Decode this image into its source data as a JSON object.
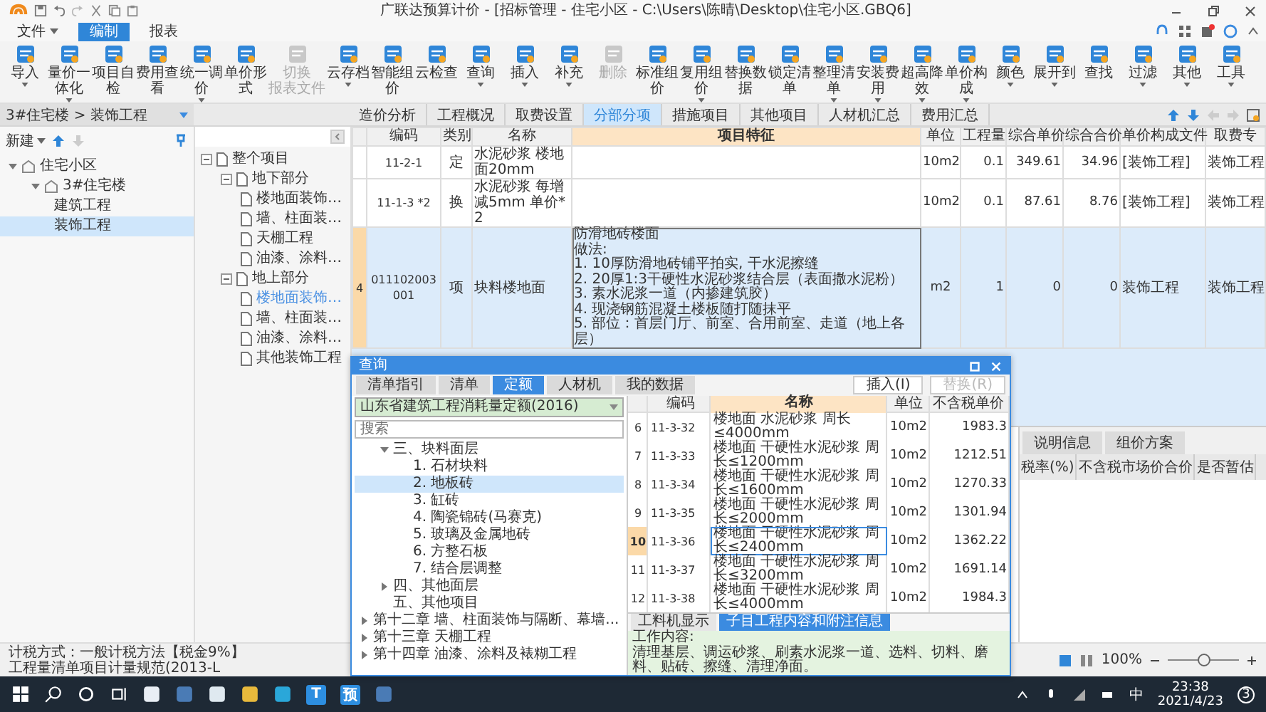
{
  "title_bar": {
    "title": "广联达预算计价 - [招标管理 - 住宅小区 - C:\\Users\\陈晴\\Desktop\\住宅小区.GBQ6]"
  },
  "menu": [
    {
      "label": "文件",
      "dropdown": true,
      "selected": false
    },
    {
      "label": "编制",
      "dropdown": false,
      "selected": true
    },
    {
      "label": "报表",
      "dropdown": false,
      "selected": false
    }
  ],
  "toolbar": [
    {
      "label": "导入",
      "dropdown": true,
      "disabled": false
    },
    {
      "label": "量价一体化",
      "dropdown": true,
      "disabled": false
    },
    {
      "label": "项目自检",
      "dropdown": false,
      "disabled": false
    },
    {
      "label": "费用查看",
      "dropdown": false,
      "disabled": false
    },
    {
      "label": "统一调价",
      "dropdown": true,
      "disabled": false
    },
    {
      "label": "单价形式",
      "dropdown": false,
      "disabled": false
    },
    {
      "label": "切换",
      "sub": "报表文件",
      "dropdown": false,
      "disabled": true
    },
    {
      "label": "云存档",
      "dropdown": true,
      "disabled": false
    },
    {
      "label": "智能组价",
      "dropdown": false,
      "disabled": false
    },
    {
      "label": "云检查",
      "dropdown": false,
      "disabled": false
    },
    {
      "label": "查询",
      "dropdown": true,
      "disabled": false
    },
    {
      "label": "插入",
      "dropdown": true,
      "disabled": false
    },
    {
      "label": "补充",
      "dropdown": true,
      "disabled": false
    },
    {
      "label": "删除",
      "dropdown": false,
      "disabled": true
    },
    {
      "label": "标准组价",
      "dropdown": false,
      "disabled": false
    },
    {
      "label": "复用组价",
      "dropdown": true,
      "disabled": false
    },
    {
      "label": "替换数据",
      "dropdown": false,
      "disabled": false
    },
    {
      "label": "锁定清单",
      "dropdown": false,
      "disabled": false
    },
    {
      "label": "整理清单",
      "dropdown": true,
      "disabled": false
    },
    {
      "label": "安装费用",
      "dropdown": true,
      "disabled": false
    },
    {
      "label": "超高降效",
      "dropdown": true,
      "disabled": false
    },
    {
      "label": "单价构成",
      "dropdown": true,
      "disabled": false
    },
    {
      "label": "颜色",
      "dropdown": true,
      "disabled": false
    },
    {
      "label": "展开到",
      "dropdown": true,
      "disabled": false
    },
    {
      "label": "查找",
      "dropdown": false,
      "disabled": false
    },
    {
      "label": "过滤",
      "dropdown": true,
      "disabled": false
    },
    {
      "label": "其他",
      "dropdown": true,
      "disabled": false
    },
    {
      "label": "工具",
      "dropdown": true,
      "disabled": false
    }
  ],
  "breadcrumb": "3#住宅楼 > 装饰工程",
  "view_tabs": [
    {
      "label": "造价分析",
      "selected": false
    },
    {
      "label": "工程概况",
      "selected": false
    },
    {
      "label": "取费设置",
      "selected": false
    },
    {
      "label": "分部分项",
      "selected": true
    },
    {
      "label": "措施项目",
      "selected": false
    },
    {
      "label": "其他项目",
      "selected": false
    },
    {
      "label": "人材机汇总",
      "selected": false
    },
    {
      "label": "费用汇总",
      "selected": false
    }
  ],
  "project_tree": {
    "new_label": "新建",
    "items": [
      {
        "label": "住宅小区",
        "expanded": true,
        "selected": false,
        "children": [
          {
            "label": "3#住宅楼",
            "expanded": true,
            "selected": false,
            "children": [
              {
                "label": "建筑工程",
                "selected": false
              },
              {
                "label": "装饰工程",
                "selected": true
              }
            ]
          }
        ]
      }
    ]
  },
  "section_tree": {
    "items": [
      {
        "label": "整个项目",
        "expanded": true,
        "selected": false,
        "children": [
          {
            "label": "地下部分",
            "expanded": true,
            "selected": false,
            "children": [
              {
                "label": "楼地面装饰…",
                "selected": false
              },
              {
                "label": "墙、柱面装…",
                "selected": false
              },
              {
                "label": "天棚工程",
                "selected": false
              },
              {
                "label": "油漆、涂料…",
                "selected": false
              }
            ]
          },
          {
            "label": "地上部分",
            "expanded": true,
            "selected": false,
            "children": [
              {
                "label": "楼地面装饰…",
                "selected": true
              },
              {
                "label": "墙、柱面装…",
                "selected": false
              },
              {
                "label": "油漆、涂料…",
                "selected": false
              },
              {
                "label": "其他装饰工程",
                "selected": false
              }
            ]
          }
        ]
      }
    ]
  },
  "table": {
    "columns": [
      "编码",
      "类别",
      "名称",
      "项目特征",
      "单位",
      "工程量",
      "综合单价",
      "综合合价",
      "单价构成文件",
      "取费专"
    ],
    "rows": [
      {
        "index": "",
        "selected": false,
        "cells": [
          "11-2-1",
          "定",
          "水泥砂浆 楼地面20mm",
          "",
          "10m2",
          "0.1",
          "349.61",
          "34.96",
          "[装饰工程]",
          "装饰工程"
        ]
      },
      {
        "index": "",
        "selected": false,
        "cells": [
          "11-1-3 *2",
          "换",
          "水泥砂浆 每增减5mm  单价*2",
          "",
          "10m2",
          "0.1",
          "87.61",
          "8.76",
          "[装饰工程]",
          "装饰工程"
        ]
      },
      {
        "index": "4",
        "selected": true,
        "cells": [
          "011102003001",
          "项",
          "块料楼地面",
          [
            "防滑地砖楼面",
            "做法:",
            "1. 10厚防滑地砖铺平拍实, 干水泥擦缝",
            "2. 20厚1:3干硬性水泥砂浆结合层（表面撒水泥粉）",
            "3. 素水泥浆一道（内掺建筑胶）",
            "4. 现浇钢筋混凝土楼板随打随抹平",
            "5. 部位：首层门厅、前室、合用前室、走道（地上各层）"
          ],
          "m2",
          "1",
          "0",
          "0",
          "装饰工程",
          "装饰工程"
        ]
      }
    ]
  },
  "detail_panel": {
    "tabs": [
      {
        "label": "说明信息",
        "selected": false
      },
      {
        "label": "组价方案",
        "selected": false
      }
    ],
    "columns": [
      "税率(%)",
      "不含税市场价合价",
      "是否暂估"
    ]
  },
  "dialog": {
    "title": "查询",
    "tabs": [
      {
        "label": "清单指引",
        "selected": false
      },
      {
        "label": "清单",
        "selected": false
      },
      {
        "label": "定额",
        "selected": true
      },
      {
        "label": "人材机",
        "selected": false
      },
      {
        "label": "我的数据",
        "selected": false
      }
    ],
    "buttons": [
      {
        "label": "插入(I)",
        "disabled": false
      },
      {
        "label": "替换(R)",
        "disabled": true
      }
    ],
    "library": "山东省建筑工程消耗量定额(2016)",
    "search": {
      "placeholder": "搜索"
    },
    "tree": [
      {
        "children": [
          {
            "label": "三、块料面层",
            "expanded": true,
            "selected": false,
            "children": [
              {
                "label": "1. 石材块料",
                "selected": false
              },
              {
                "label": "2. 地板砖",
                "selected": true
              },
              {
                "label": "3. 缸砖",
                "selected": false
              },
              {
                "label": "4. 陶瓷锦砖(马赛克)",
                "selected": false
              },
              {
                "label": "5. 玻璃及金属地砖",
                "selected": false
              },
              {
                "label": "6. 方整石板",
                "selected": false
              },
              {
                "label": "7. 结合层调整",
                "selected": false
              }
            ]
          },
          {
            "label": "四、其他面层",
            "expanded": false,
            "selected": false
          },
          {
            "label": "五、其他项目",
            "selected": false
          }
        ]
      },
      {
        "label": "第十二章 墙、柱面装饰与隔断、幕墙...",
        "expanded": false,
        "selected": false
      },
      {
        "label": "第十三章 天棚工程",
        "expanded": false,
        "selected": false
      },
      {
        "label": "第十四章 油漆、涂料及裱糊工程",
        "expanded": false,
        "selected": false
      }
    ],
    "columns": [
      "编码",
      "名称",
      "单位",
      "不含税单价"
    ],
    "rows": [
      {
        "no": "6",
        "code": "11-3-32",
        "name": "楼地面 水泥砂浆 周长≤4000mm",
        "unit": "10m2",
        "price": "1983.3",
        "selected": false
      },
      {
        "no": "7",
        "code": "11-3-33",
        "name": "楼地面 干硬性水泥砂浆 周长≤1200mm",
        "unit": "10m2",
        "price": "1212.51",
        "selected": false
      },
      {
        "no": "8",
        "code": "11-3-34",
        "name": "楼地面 干硬性水泥砂浆 周长≤1600mm",
        "unit": "10m2",
        "price": "1270.33",
        "selected": false
      },
      {
        "no": "9",
        "code": "11-3-35",
        "name": "楼地面 干硬性水泥砂浆 周长≤2000mm",
        "unit": "10m2",
        "price": "1301.94",
        "selected": false
      },
      {
        "no": "10",
        "code": "11-3-36",
        "name": "楼地面 干硬性水泥砂浆 周长≤2400mm",
        "unit": "10m2",
        "price": "1362.22",
        "selected": true
      },
      {
        "no": "11",
        "code": "11-3-37",
        "name": "楼地面 干硬性水泥砂浆 周长≤3200mm",
        "unit": "10m2",
        "price": "1691.14",
        "selected": false
      },
      {
        "no": "12",
        "code": "11-3-38",
        "name": "楼地面 干硬性水泥砂浆 周长≤4000mm",
        "unit": "10m2",
        "price": "1984.3",
        "selected": false
      }
    ],
    "info_tabs": [
      {
        "label": "工料机显示",
        "selected": false
      },
      {
        "label": "子目工程内容和附注信息",
        "selected": true
      }
    ],
    "info_heading": "工作内容:",
    "info_text": "清理基层、调运砂浆、刷素水泥浆一道、选料、切料、磨料、贴砖、擦缝、清理净面。"
  },
  "status_bar": {
    "tax": "计税方式：一般计税方法【税金9%】",
    "spec": "工程量清单项目计量规范(2013-L",
    "zoom": "100%",
    "zoom_slider": {
      "level": 0.5
    }
  },
  "taskbar": {
    "apps": [
      {
        "kind": "tile"
      },
      {
        "kind": "tile"
      },
      {
        "kind": "tile"
      },
      {
        "kind": "tile"
      },
      {
        "kind": "tile"
      },
      {
        "kind": "glyph",
        "glyph": "T"
      },
      {
        "kind": "glyph",
        "glyph": "预"
      },
      {
        "kind": "tile"
      }
    ],
    "ime": "中",
    "time": "23:38",
    "date": "2021/4/23",
    "notifications": "3"
  }
}
